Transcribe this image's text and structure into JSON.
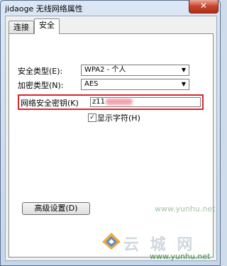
{
  "window": {
    "title": "jidaoge 无线网络属性",
    "close_glyph": "✕"
  },
  "tabs": [
    {
      "label": "连接"
    },
    {
      "label": "安全"
    }
  ],
  "security": {
    "security_type_label": "安全类型(E):",
    "security_type_value": "WPA2 - 个人",
    "encryption_type_label": "加密类型(N):",
    "encryption_type_value": "AES",
    "network_key_label": "网络安全密钥(K)",
    "network_key_value": "z11",
    "show_characters_label": "显示字符(H)",
    "show_characters_checked": true,
    "advanced_button_label": "高级设置(D)"
  },
  "watermark": {
    "text": "云 城 网",
    "url": "www.yunhu.net",
    "faded_text": "www.yunhu.net"
  }
}
